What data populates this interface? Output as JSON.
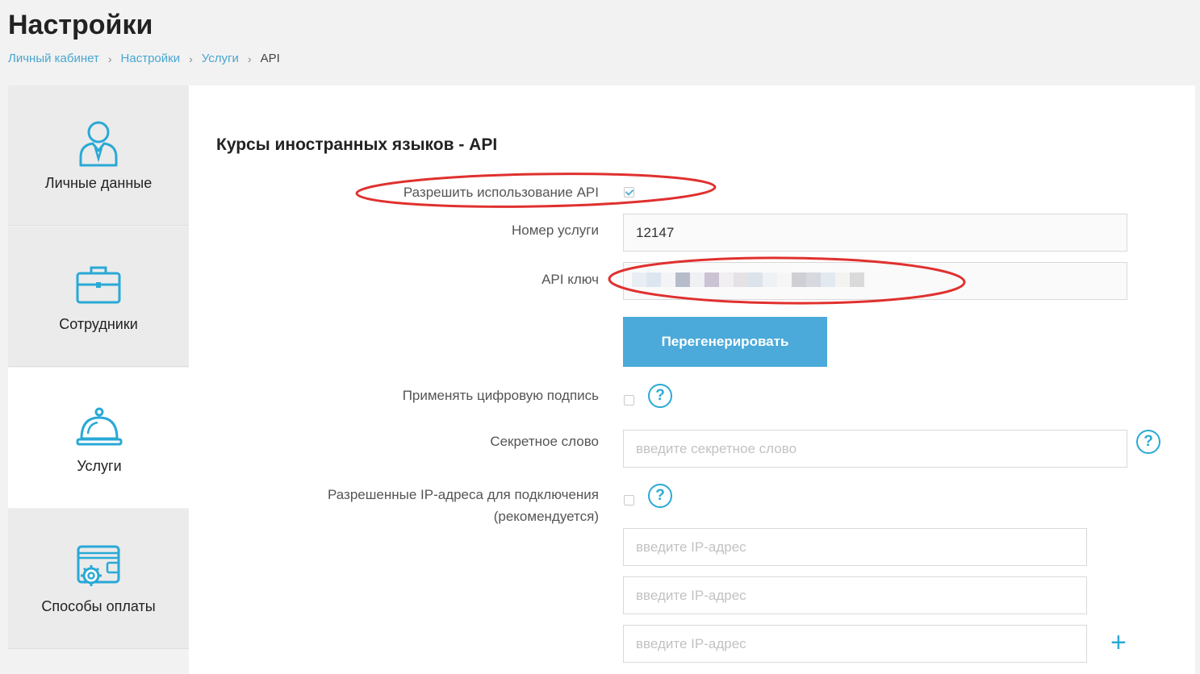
{
  "header": {
    "title": "Настройки",
    "breadcrumbs": [
      {
        "label": "Личный кабинет"
      },
      {
        "label": "Настройки"
      },
      {
        "label": "Услуги"
      },
      {
        "label": "API"
      }
    ]
  },
  "sidebar": {
    "items": [
      {
        "label": "Личные данные",
        "icon": "user-icon",
        "active": false
      },
      {
        "label": "Сотрудники",
        "icon": "briefcase-icon",
        "active": false
      },
      {
        "label": "Услуги",
        "icon": "service-bell-icon",
        "active": true
      },
      {
        "label": "Способы оплаты",
        "icon": "wallet-gear-icon",
        "active": false
      }
    ]
  },
  "form": {
    "section_title": "Курсы иностранных языков - API",
    "allow_api": {
      "label": "Разрешить использование API",
      "checked": true
    },
    "service_number": {
      "label": "Номер услуги",
      "value": "12147"
    },
    "api_key": {
      "label": "API ключ"
    },
    "regenerate_label": "Перегенерировать",
    "digital_signature": {
      "label": "Применять цифровую подпись",
      "checked": false
    },
    "secret_word": {
      "label": "Секретное слово",
      "placeholder": "введите секретное слово"
    },
    "allowed_ips": {
      "label_line1": "Разрешенные IP-адреса для подключения",
      "label_line2": "(рекомендуется)",
      "checked": false,
      "inputs": [
        {
          "placeholder": "введите IP-адрес"
        },
        {
          "placeholder": "введите IP-адрес"
        },
        {
          "placeholder": "введите IP-адрес"
        }
      ]
    },
    "help_glyph": "?",
    "add_glyph": "+"
  },
  "colors": {
    "accent": "#29a9d6",
    "button": "#4baad9",
    "link": "#49a6cf",
    "annotation": "#e0302e"
  }
}
